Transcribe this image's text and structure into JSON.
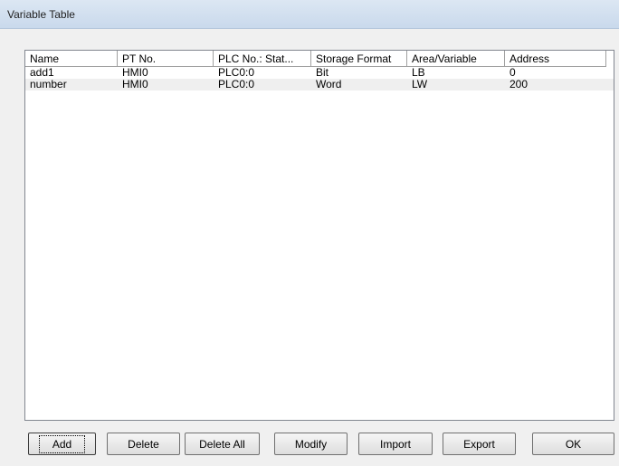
{
  "window": {
    "title": "Variable Table"
  },
  "table": {
    "columns": [
      "Name",
      "PT No.",
      "PLC No.: Stat...",
      "Storage Format",
      "Area/Variable",
      "Address"
    ],
    "rows": [
      [
        "add1",
        "HMI0",
        "PLC0:0",
        "Bit",
        "LB",
        "0"
      ],
      [
        "number",
        "HMI0",
        "PLC0:0",
        "Word",
        "LW",
        "200"
      ]
    ]
  },
  "buttons": {
    "add": "Add",
    "delete": "Delete",
    "delete_all": "Delete All",
    "modify": "Modify",
    "import": "Import",
    "export": "Export",
    "ok": "OK"
  }
}
